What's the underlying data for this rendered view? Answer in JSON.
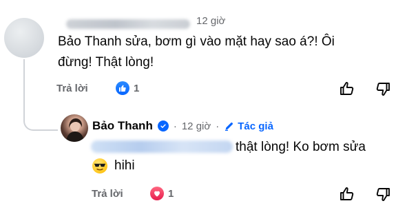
{
  "comment1": {
    "time": "12 giờ",
    "text_line1": "Bảo Thanh sửa, bơm gì vào mặt hay sao á?! Ôi",
    "text_line2": "đừng! Thật lòng!",
    "reply_label": "Trả lời",
    "reaction_icon": "like-icon",
    "reaction_count": "1",
    "upvote_icon": "thumbs-up-icon",
    "downvote_icon": "thumbs-down-icon"
  },
  "reply": {
    "author_name": "Bảo Thanh",
    "verified_icon": "verified-badge-icon",
    "separator": "·",
    "time": "12 giờ",
    "author_label": "Tác giả",
    "author_icon": "pencil-icon",
    "text_line1": "thật lòng! Ko bơm sửa",
    "emoji_icon": "sunglasses-emoji",
    "text_line2": "hihi",
    "reply_label": "Trả lời",
    "reaction_icon": "love-icon",
    "reaction_count": "1"
  },
  "colors": {
    "accent": "#0866ff",
    "love": "#e61e4d",
    "muted_text": "#65676b"
  }
}
